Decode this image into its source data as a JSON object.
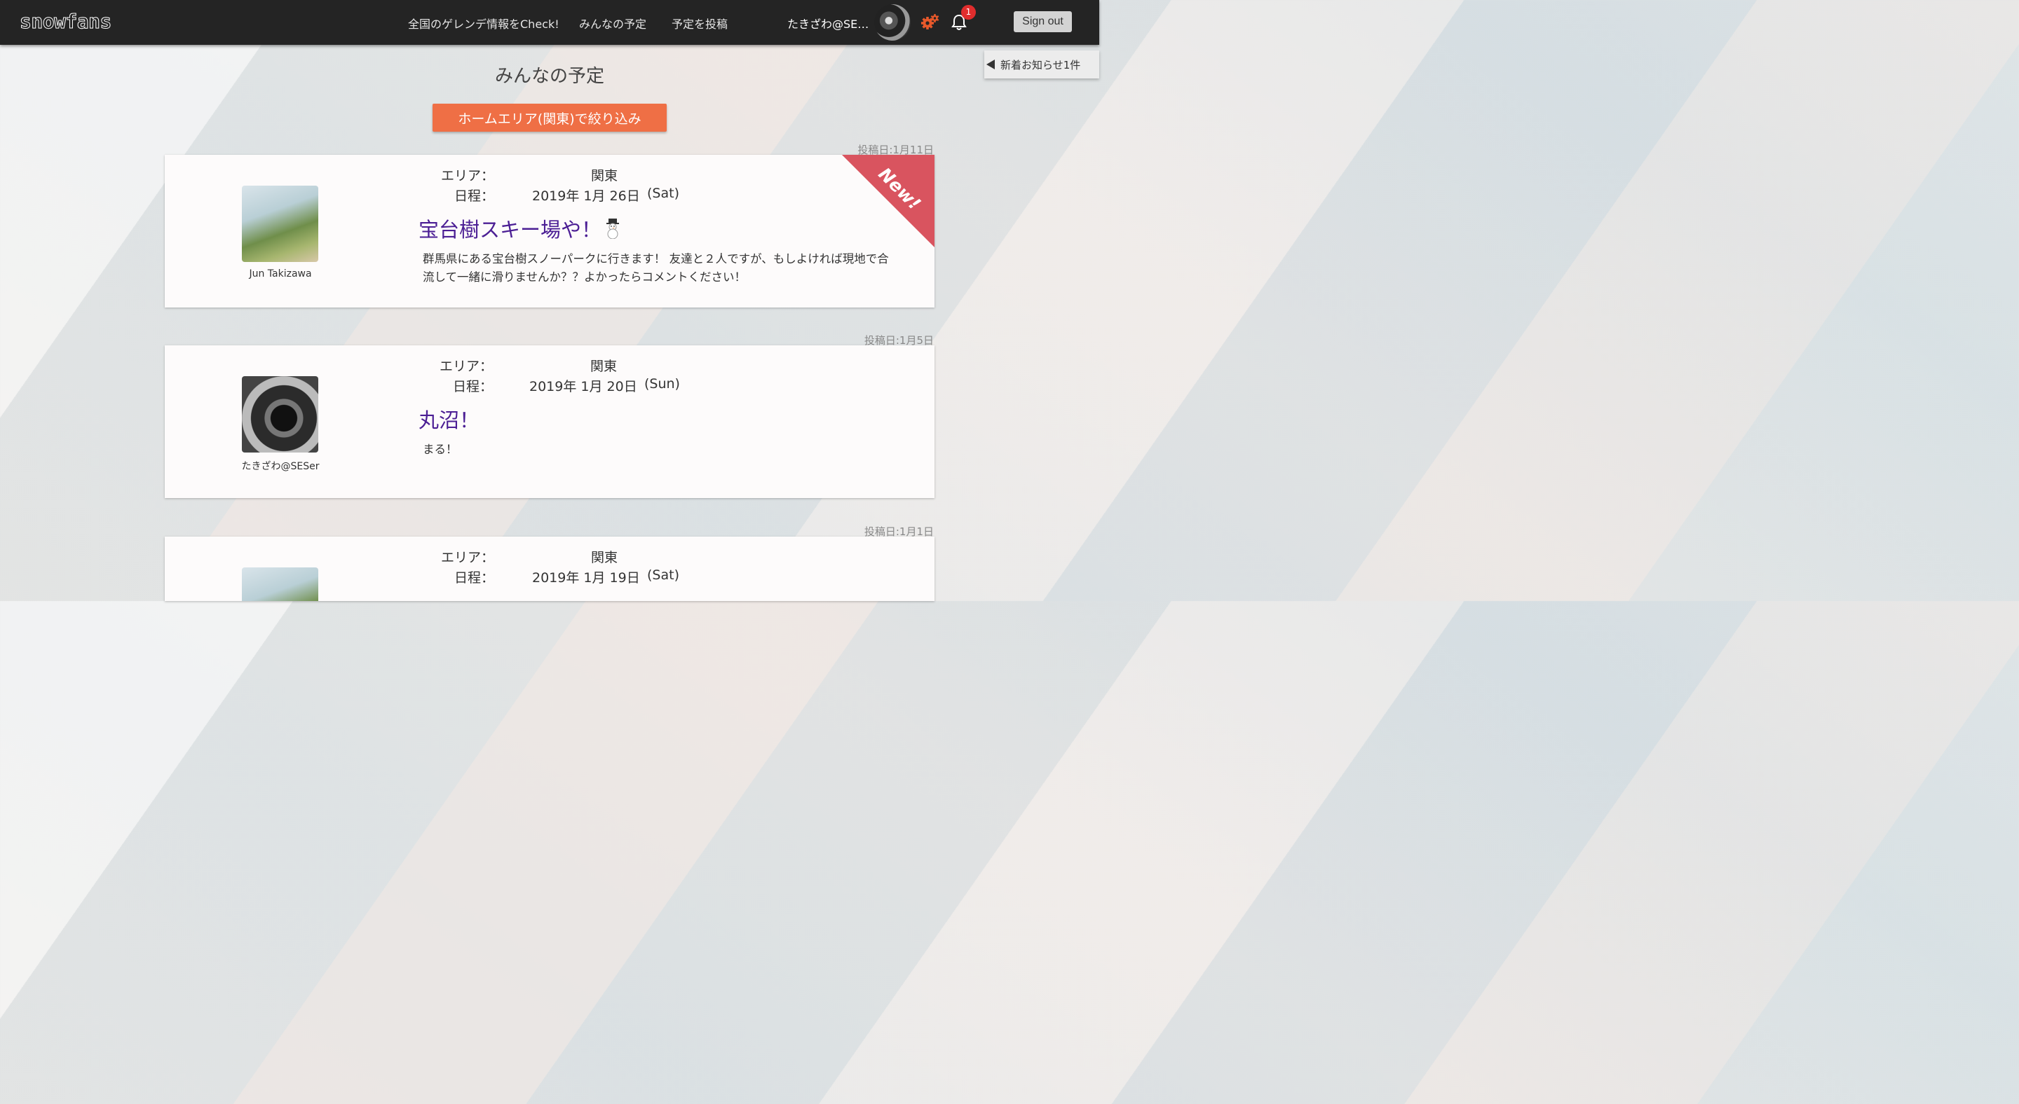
{
  "header": {
    "logo": "snowfans",
    "nav": [
      "全国のゲレンデ情報をCheck!",
      "みんなの予定",
      "予定を投稿"
    ],
    "username": "たきざわ@SES…",
    "notification_count": "1",
    "signout_label": "Sign out"
  },
  "notice": {
    "label": "新着お知らせ1件"
  },
  "page": {
    "title": "みんなの予定",
    "filter_label": "ホームエリア(関東)で絞り込み"
  },
  "labels": {
    "area": "エリア：",
    "schedule": "日程："
  },
  "posts": [
    {
      "post_date": "投稿日:1月11日",
      "author": "Jun Takizawa",
      "area": "関東",
      "date": "2019年 1月 26日",
      "weekday": "(Sat)",
      "title": "宝台樹スキー場や！",
      "description": "群馬県にある宝台樹スノーパークに行きます！ 友達と２人ですが、もしよければ現地で合流して一緒に滑りませんか？？よかったらコメントください！",
      "badge": "New!"
    },
    {
      "post_date": "投稿日:1月5日",
      "author": "たきざわ@SESer",
      "area": "関東",
      "date": "2019年 1月 20日",
      "weekday": "(Sun)",
      "title": "丸沼！",
      "description": "まる！"
    },
    {
      "post_date": "投稿日:1月1日",
      "area": "関東",
      "date": "2019年 1月 19日",
      "weekday": "(Sat)"
    }
  ],
  "colors": {
    "accent": "#ef6f45",
    "title": "#4b1e94",
    "ribbon": "#d9545f",
    "topbar": "#242424"
  }
}
